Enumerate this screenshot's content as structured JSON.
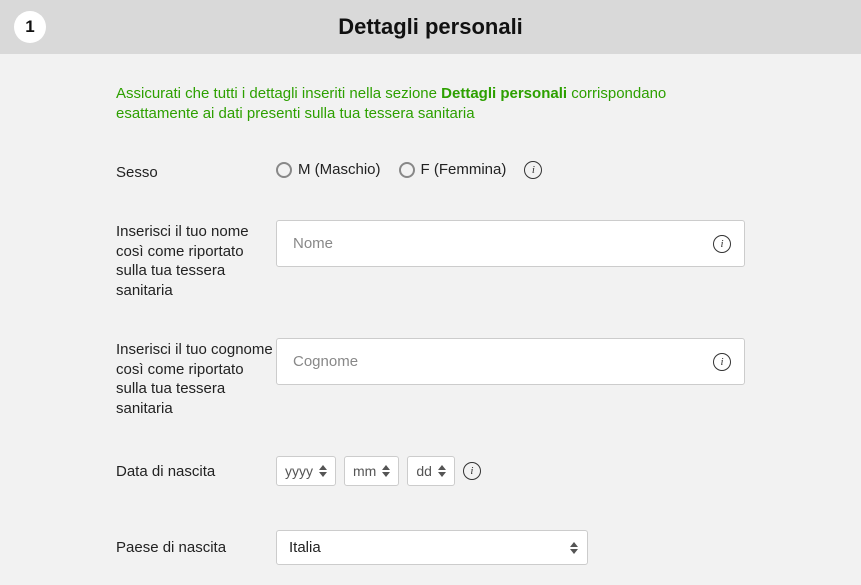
{
  "header": {
    "step_number": "1",
    "title": "Dettagli personali"
  },
  "notice": {
    "prefix": "Assicurati che tutti i dettagli inseriti nella sezione ",
    "bold": "Dettagli personali",
    "suffix": " corrispondano esattamente ai dati presenti sulla tua tessera sanitaria"
  },
  "fields": {
    "gender": {
      "label": "Sesso",
      "option_m": "M (Maschio)",
      "option_f": "F (Femmina)"
    },
    "first_name": {
      "label": "Inserisci il tuo nome così come riportato sulla tua tessera sanitaria",
      "placeholder": "Nome"
    },
    "last_name": {
      "label": "Inserisci il tuo cognome così come riportato sulla tua tessera sanitaria",
      "placeholder": "Cognome"
    },
    "dob": {
      "label": "Data di nascita",
      "year": "yyyy",
      "month": "mm",
      "day": "dd"
    },
    "birth_country": {
      "label": "Paese di nascita",
      "selected": "Italia"
    }
  },
  "info_glyph": "i"
}
